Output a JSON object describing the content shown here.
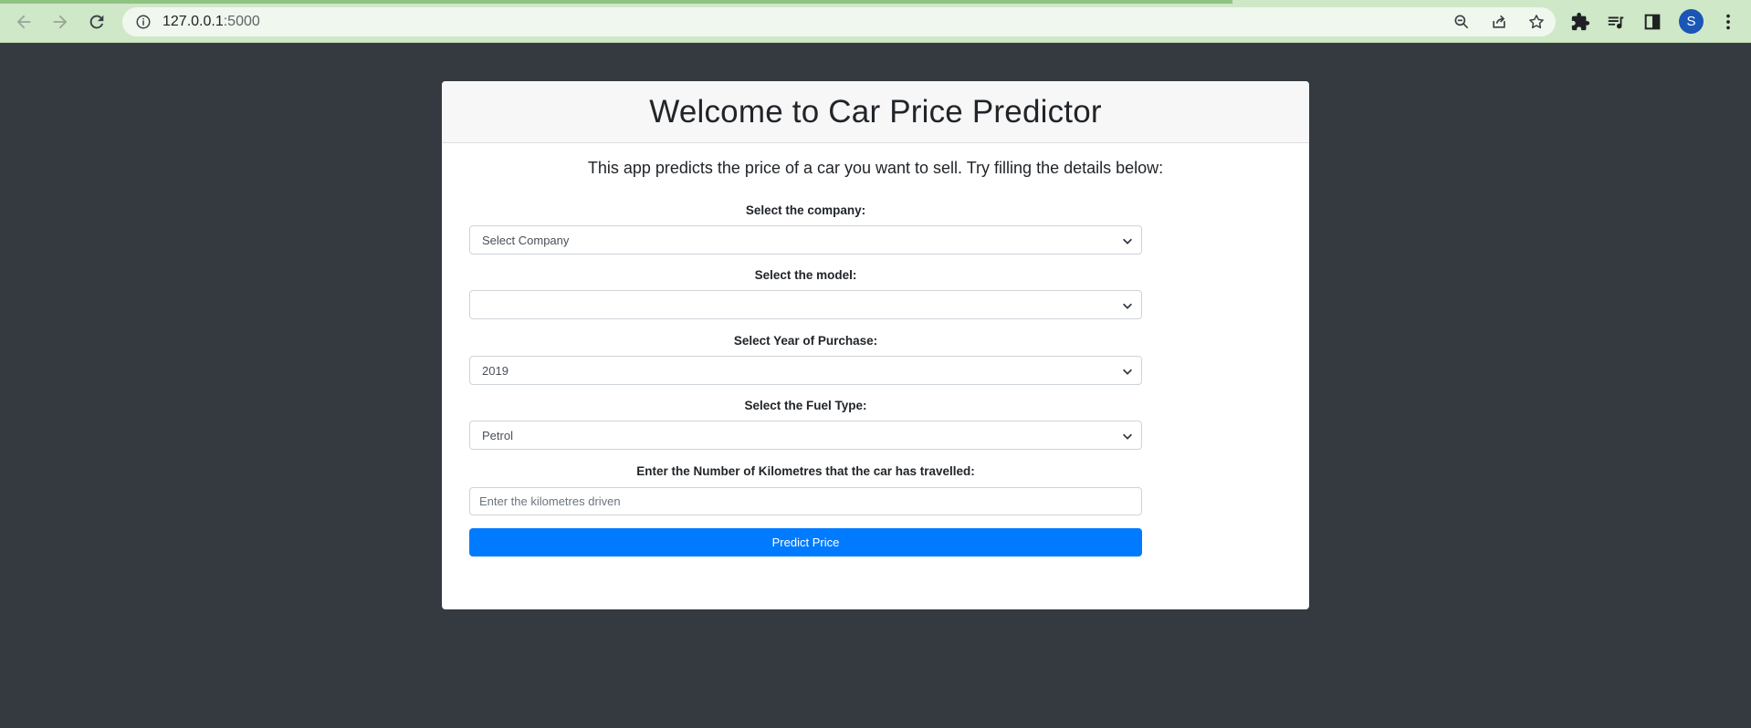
{
  "browser": {
    "url_host": "127.0.0.1",
    "url_port": ":5000",
    "profile_initial": "S",
    "icons": [
      "back-icon",
      "forward-icon",
      "reload-icon",
      "site-info-icon",
      "zoom-icon",
      "share-icon",
      "bookmark-star-icon",
      "extensions-icon",
      "media-controls-icon",
      "side-panel-icon",
      "more-menu-icon"
    ]
  },
  "page": {
    "title": "Welcome to Car Price Predictor",
    "subtitle": "This app predicts the price of a car you want to sell. Try filling the details below:",
    "fields": {
      "company": {
        "label": "Select the company:",
        "value": "Select Company"
      },
      "model": {
        "label": "Select the model:",
        "value": ""
      },
      "year": {
        "label": "Select Year of Purchase:",
        "value": "2019"
      },
      "fuel": {
        "label": "Select the Fuel Type:",
        "value": "Petrol"
      },
      "kms": {
        "label": "Enter the Number of Kilometres that the car has travelled:",
        "placeholder": "Enter the kilometres driven",
        "value": ""
      }
    },
    "predict_button": "Predict Price"
  },
  "colors": {
    "page_background": "#343a40",
    "browser_frame": "#cfe8c8",
    "primary_button": "#007bff",
    "avatar": "#1a56b5"
  }
}
